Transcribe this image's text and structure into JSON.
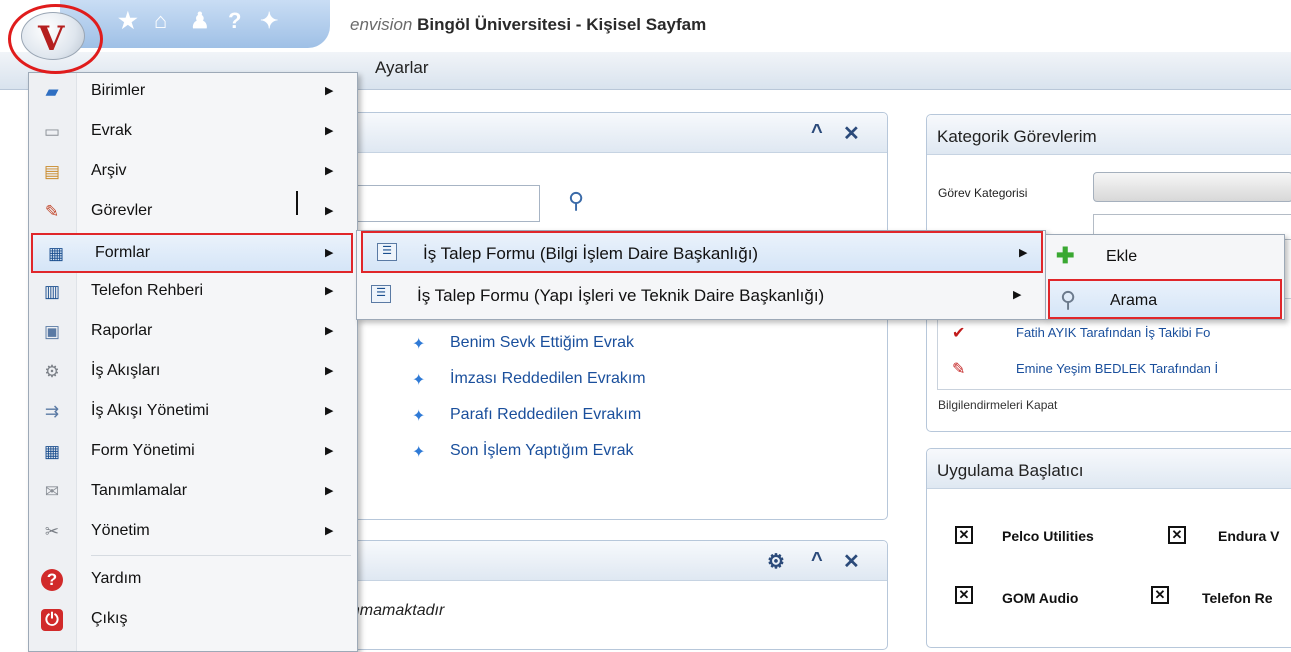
{
  "titlebar": {
    "brand": "envision",
    "title": "Bingöl Üniversitesi - Kişisel Sayfam",
    "quick_icons": [
      "star-icon",
      "home-icon",
      "user-icon",
      "help-icon",
      "network-icon"
    ]
  },
  "ribbon": {
    "settings_label": "Ayarlar"
  },
  "main_menu": {
    "items": [
      {
        "label": "Birimler",
        "icon": "folder-icon"
      },
      {
        "label": "Evrak",
        "icon": "document-icon"
      },
      {
        "label": "Arşiv",
        "icon": "archive-icon"
      },
      {
        "label": "Görevler",
        "icon": "task-icon"
      },
      {
        "label": "Formlar",
        "icon": "form-icon"
      },
      {
        "label": "Telefon Rehberi",
        "icon": "phonebook-icon"
      },
      {
        "label": "Raporlar",
        "icon": "report-icon"
      },
      {
        "label": "İş Akışları",
        "icon": "workflow-icon"
      },
      {
        "label": "İş Akışı Yönetimi",
        "icon": "workflow-management-icon"
      },
      {
        "label": "Form Yönetimi",
        "icon": "form-management-icon"
      },
      {
        "label": "Tanımlamalar",
        "icon": "definitions-icon"
      },
      {
        "label": "Yönetim",
        "icon": "tools-icon"
      },
      {
        "label": "Yardım",
        "icon": "help-icon"
      },
      {
        "label": "Çıkış",
        "icon": "power-icon"
      }
    ]
  },
  "forms_submenu": {
    "items": [
      {
        "label": "İş Talep Formu (Bilgi İşlem Daire Başkanlığı)"
      },
      {
        "label": "İş Talep Formu (Yapı İşleri ve Teknik Daire Başkanlığı)"
      }
    ]
  },
  "action_menu": {
    "items": [
      {
        "label": "Ekle",
        "icon": "add-icon"
      },
      {
        "label": "Arama",
        "icon": "search-icon"
      }
    ]
  },
  "left_panel": {
    "links": [
      "Benim Sevk Ettiğim Evrak",
      "İmzası Reddedilen Evrakım",
      "Parafı Reddedilen Evrakım",
      "Son İşlem Yaptığım Evrak"
    ],
    "empty_text": "unmamaktadır"
  },
  "kategorik": {
    "title": "Kategorik Görevlerim",
    "category_label": "Görev Kategorisi",
    "tasks": [
      "Fatih AYIK Tarafından İş Takibi Fo",
      "Emine Yeşim BEDLEK Tarafından İ"
    ],
    "dismiss_link": "Bilgilendirmeleri Kapat"
  },
  "launcher": {
    "title": "Uygulama Başlatıcı",
    "apps": [
      "Pelco Utilities",
      "Endura V",
      "GOM Audio",
      "Telefon Re"
    ]
  }
}
